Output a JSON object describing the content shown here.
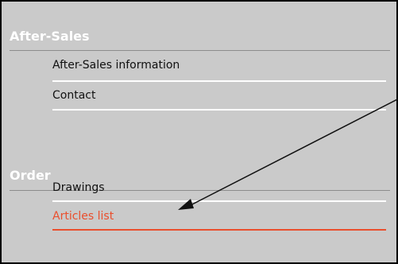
{
  "menu": {
    "sections": [
      {
        "title": "After-Sales",
        "items": [
          {
            "label": "After-Sales information"
          },
          {
            "label": "Contact"
          }
        ]
      },
      {
        "title": "Order",
        "items": [
          {
            "label": "Drawings"
          },
          {
            "label": "Articles list"
          }
        ]
      }
    ]
  },
  "colors": {
    "panel_background": "#cacaca",
    "section_header": "#ffffff",
    "item_text": "#111111",
    "active_item": "#ea4f2d",
    "border": "#000000"
  },
  "icons": {
    "annotation": "arrow-icon"
  }
}
